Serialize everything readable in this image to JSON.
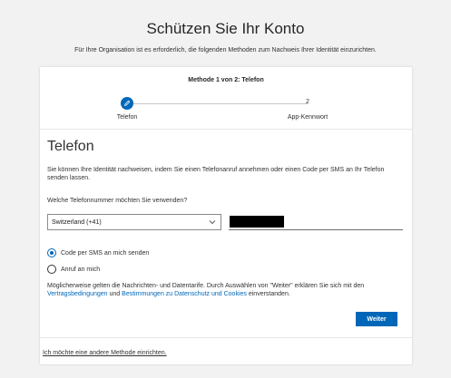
{
  "page": {
    "title": "Schützen Sie Ihr Konto",
    "subtitle": "Für Ihre Organisation ist es erforderlich, die folgenden Methoden zum Nachweis Ihrer Identität einzurichten."
  },
  "wizard": {
    "heading": "Methode 1 von 2: Telefon",
    "steps": [
      {
        "label": "Telefon",
        "status": "active",
        "icon": "pencil-icon"
      },
      {
        "number": "2",
        "label": "App-Kennwort",
        "status": "pending"
      }
    ]
  },
  "section": {
    "title": "Telefon",
    "description": "Sie können Ihre Identität nachweisen, indem Sie einen Telefonanruf annehmen oder einen Code per SMS an Ihr Telefon senden lassen.",
    "question": "Welche Telefonnummer möchten Sie verwenden?"
  },
  "form": {
    "country": "Switzerland (+41)",
    "phone_value_redacted": true,
    "options": [
      {
        "label": "Code per SMS an mich senden",
        "checked": true
      },
      {
        "label": "Anruf an mich",
        "checked": false
      }
    ]
  },
  "legal": {
    "prefix": "Möglicherweise gelten die Nachrichten- und Datentarife. Durch Auswählen von \"Weiter\" erklären Sie sich mit den",
    "link1": "Vertragsbedingungen",
    "and": "und",
    "link2": "Bestimmungen zu Datenschutz und Cookies",
    "suffix": "einverstanden."
  },
  "buttons": {
    "next": "Weiter"
  },
  "footer": {
    "other_method": "Ich möchte eine andere Methode einrichten."
  },
  "colors": {
    "accent": "#0067b8",
    "background": "#f2f2f2",
    "card": "#ffffff"
  }
}
